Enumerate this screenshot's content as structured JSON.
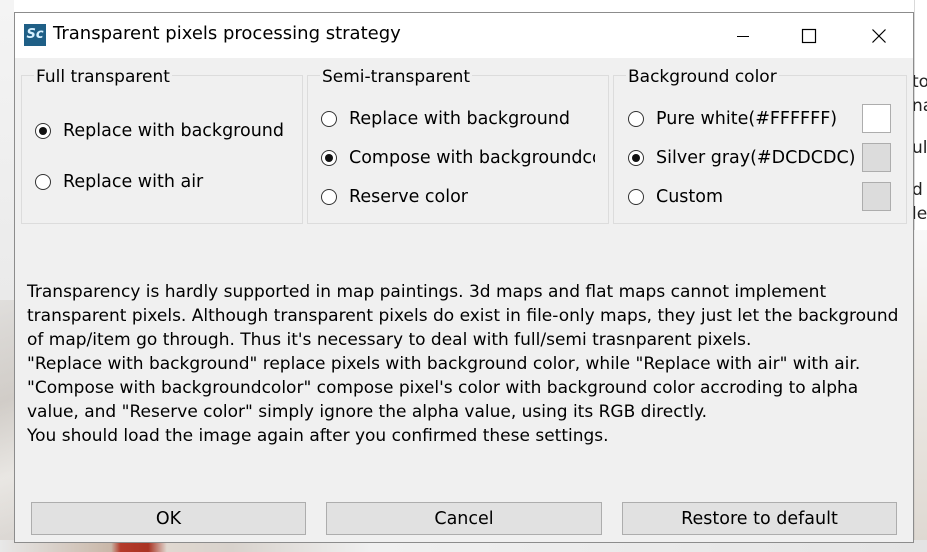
{
  "window": {
    "title": "Transparent pixels processing strategy",
    "icon_label": "Sc",
    "controls": [
      "minimize-icon",
      "maximize-icon",
      "close-icon"
    ]
  },
  "background_snippets": [
    "to",
    "na",
    "ul",
    "d",
    "le"
  ],
  "groups": {
    "full_transparent": {
      "legend": "Full transparent",
      "options": [
        {
          "label": "Replace with background",
          "selected": true
        },
        {
          "label": "Replace with air",
          "selected": false
        }
      ]
    },
    "semi_transparent": {
      "legend": "Semi-transparent",
      "options": [
        {
          "label": "Replace with background",
          "selected": false
        },
        {
          "label": "Compose with backgroundcolor",
          "selected": true
        },
        {
          "label": "Reserve color",
          "selected": false
        }
      ]
    },
    "background_color": {
      "legend": "Background color",
      "options": [
        {
          "label": "Pure white(#FFFFFF)",
          "selected": false,
          "swatch": "#FFFFFF"
        },
        {
          "label": "Silver gray(#DCDCDC)",
          "selected": true,
          "swatch": "#DCDCDC"
        },
        {
          "label": "Custom",
          "selected": false,
          "swatch": "#DCDCDC"
        }
      ]
    }
  },
  "description": [
    "Transparency is hardly supported in map paintings. 3d maps and flat maps cannot implement",
    "transparent pixels. Although transparent pixels do exist in file-only maps, they just let the background",
    "of map/item go through. Thus it's necessary to deal with full/semi trasnparent pixels.",
    "\"Replace with background\" replace pixels with background color, while \"Replace with air\" with air.",
    "\"Compose with backgroundcolor\" compose pixel's color with background color accroding to alpha",
    "value, and \"Reserve color\" simply ignore the alpha value, using its RGB directly.",
    "You should load the image again after you confirmed these settings."
  ],
  "buttons": {
    "ok": "OK",
    "cancel": "Cancel",
    "restore": "Restore to default"
  }
}
